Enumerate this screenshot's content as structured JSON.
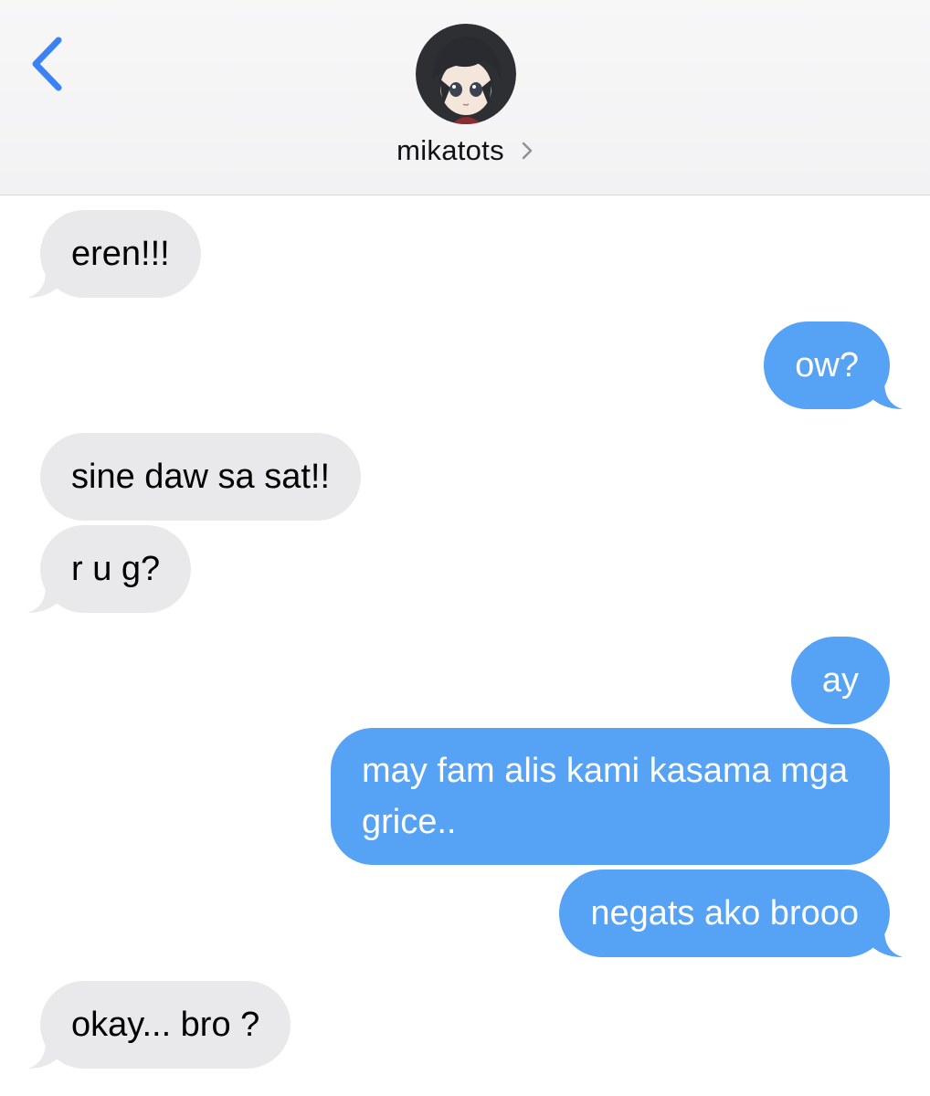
{
  "header": {
    "contact_name": "mikatots",
    "icons": {
      "back": "chevron-left-icon",
      "details": "chevron-right-icon",
      "avatar": "contact-avatar"
    }
  },
  "colors": {
    "accent": "#3a82f6",
    "incoming_bubble": "#e9e9eb",
    "outgoing_bubble": "#56a2f5",
    "header_bg": "#f5f5f7"
  },
  "messages": [
    {
      "direction": "incoming",
      "text": "eren!!!"
    },
    {
      "direction": "outgoing",
      "text": "ow?"
    },
    {
      "direction": "incoming",
      "text": "sine daw sa sat!!"
    },
    {
      "direction": "incoming",
      "text": "r u g?"
    },
    {
      "direction": "outgoing",
      "text": "ay"
    },
    {
      "direction": "outgoing",
      "text": "may fam alis kami kasama mga grice.."
    },
    {
      "direction": "outgoing",
      "text": "negats ako brooo"
    },
    {
      "direction": "incoming",
      "text": "okay... bro ?"
    }
  ]
}
